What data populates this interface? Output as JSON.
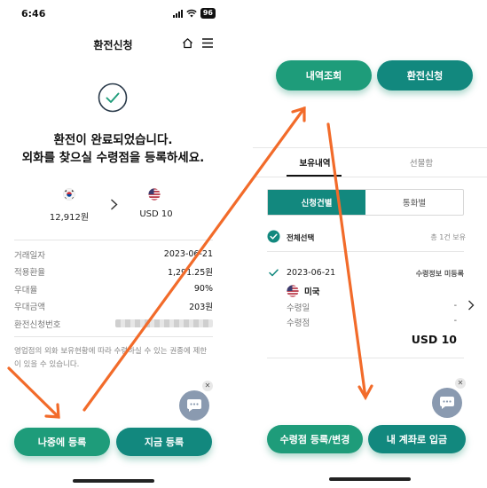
{
  "colors": {
    "accent_green": "#1e9c7a",
    "accent_teal": "#12887e",
    "arrow": "#f26b2a",
    "fab": "#8a9ab0"
  },
  "left": {
    "status": {
      "time": "6:46",
      "battery": "96"
    },
    "header": {
      "title": "환전신청"
    },
    "result": {
      "line1": "환전이 완료되었습니다.",
      "line2": "외화를 찾으실 수령점을 등록하세요."
    },
    "exchange": {
      "from_amount": "12,912원",
      "to_amount": "USD 10"
    },
    "details": [
      {
        "label": "거래일자",
        "value": "2023-06-21"
      },
      {
        "label": "적용환율",
        "value": "1,291.25원"
      },
      {
        "label": "우대율",
        "value": "90%"
      },
      {
        "label": "우대금액",
        "value": "203원"
      },
      {
        "label": "환전신청번호",
        "value": ""
      }
    ],
    "notice": {
      "line1": "영업점의 외화 보유현황에 따라 수령하실 수 있는 권종에 제한",
      "line2": "이 있을 수 있습니다."
    },
    "buttons": {
      "later": "나중에 등록",
      "now": "지금 등록"
    }
  },
  "right": {
    "top_buttons": {
      "history": "내역조회",
      "apply": "환전신청"
    },
    "tabs": {
      "holding": "보유내역",
      "gift": "선물함"
    },
    "segment": {
      "by_application": "신청건별",
      "by_currency": "통화별"
    },
    "select_all": "전체선택",
    "count": "총 1건 보유",
    "item": {
      "date": "2023-06-21",
      "status": "수령정보 미등록",
      "country": "미국",
      "receive_date_label": "수령일",
      "receive_date_value": "-",
      "branch_label": "수령점",
      "branch_value": "-",
      "amount": "USD  10"
    },
    "buttons": {
      "register": "수령점 등록/변경",
      "deposit": "내 계좌로 입금"
    }
  }
}
